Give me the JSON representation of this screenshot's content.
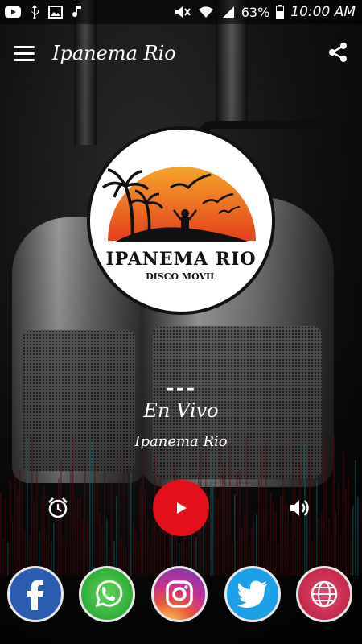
{
  "status_bar": {
    "battery": "63%",
    "time": "10:00 AM",
    "left_icons": [
      "youtube-icon",
      "usb-icon",
      "image-icon",
      "music-note-icon"
    ],
    "right_icons": [
      "mute-icon",
      "wifi-icon",
      "signal-icon",
      "battery-icon"
    ]
  },
  "appbar": {
    "title": "Ipanema Rio",
    "menu_icon": "hamburger-menu-icon",
    "share_icon": "share-icon"
  },
  "logo": {
    "name": "IPANEMA RIO",
    "tagline": "DISCO MOVIL"
  },
  "now_playing": {
    "dashes": "---",
    "track": "En Vivo",
    "artist": "Ipanema Rio"
  },
  "controls": {
    "alarm_icon": "alarm-clock-icon",
    "play_icon": "play-icon",
    "volume_icon": "volume-icon",
    "play_color": "#e2101b"
  },
  "social": [
    {
      "name": "facebook",
      "icon": "facebook-icon",
      "color": "#2b5cb0"
    },
    {
      "name": "whatsapp",
      "icon": "whatsapp-icon",
      "color": "#1b9e2a"
    },
    {
      "name": "instagram",
      "icon": "instagram-icon",
      "color": "#c5328f"
    },
    {
      "name": "twitter",
      "icon": "twitter-icon",
      "color": "#1da0e8"
    },
    {
      "name": "website",
      "icon": "globe-icon",
      "color": "#b81a3c"
    }
  ]
}
